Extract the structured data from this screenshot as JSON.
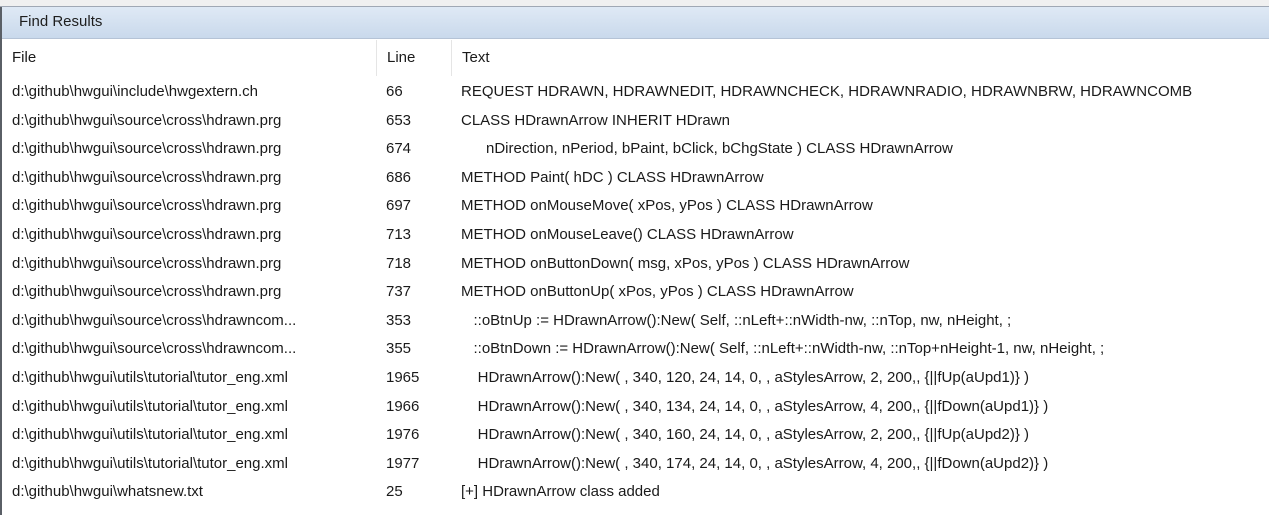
{
  "panel_title": "Find Results",
  "columns": {
    "file": "File",
    "line": "Line",
    "text": "Text"
  },
  "results": [
    {
      "file": "d:\\github\\hwgui\\include\\hwgextern.ch",
      "line": "66",
      "text": "REQUEST HDRAWN, HDRAWNEDIT, HDRAWNCHECK, HDRAWNRADIO, HDRAWNBRW, HDRAWNCOMB"
    },
    {
      "file": "d:\\github\\hwgui\\source\\cross\\hdrawn.prg",
      "line": "653",
      "text": "CLASS HDrawnArrow INHERIT HDrawn"
    },
    {
      "file": "d:\\github\\hwgui\\source\\cross\\hdrawn.prg",
      "line": "674",
      "text": "      nDirection, nPeriod, bPaint, bClick, bChgState ) CLASS HDrawnArrow"
    },
    {
      "file": "d:\\github\\hwgui\\source\\cross\\hdrawn.prg",
      "line": "686",
      "text": "METHOD Paint( hDC ) CLASS HDrawnArrow"
    },
    {
      "file": "d:\\github\\hwgui\\source\\cross\\hdrawn.prg",
      "line": "697",
      "text": "METHOD onMouseMove( xPos, yPos ) CLASS HDrawnArrow"
    },
    {
      "file": "d:\\github\\hwgui\\source\\cross\\hdrawn.prg",
      "line": "713",
      "text": "METHOD onMouseLeave() CLASS HDrawnArrow"
    },
    {
      "file": "d:\\github\\hwgui\\source\\cross\\hdrawn.prg",
      "line": "718",
      "text": "METHOD onButtonDown( msg, xPos, yPos ) CLASS HDrawnArrow"
    },
    {
      "file": "d:\\github\\hwgui\\source\\cross\\hdrawn.prg",
      "line": "737",
      "text": "METHOD onButtonUp( xPos, yPos ) CLASS HDrawnArrow"
    },
    {
      "file": "d:\\github\\hwgui\\source\\cross\\hdrawncom...",
      "line": "353",
      "text": "   ::oBtnUp := HDrawnArrow():New( Self, ::nLeft+::nWidth-nw, ::nTop, nw, nHeight, ;"
    },
    {
      "file": "d:\\github\\hwgui\\source\\cross\\hdrawncom...",
      "line": "355",
      "text": "   ::oBtnDown := HDrawnArrow():New( Self, ::nLeft+::nWidth-nw, ::nTop+nHeight-1, nw, nHeight, ;"
    },
    {
      "file": "d:\\github\\hwgui\\utils\\tutorial\\tutor_eng.xml",
      "line": "1965",
      "text": "    HDrawnArrow():New( , 340, 120, 24, 14, 0, , aStylesArrow, 2, 200,, {||fUp(aUpd1)} )"
    },
    {
      "file": "d:\\github\\hwgui\\utils\\tutorial\\tutor_eng.xml",
      "line": "1966",
      "text": "    HDrawnArrow():New( , 340, 134, 24, 14, 0, , aStylesArrow, 4, 200,, {||fDown(aUpd1)} )"
    },
    {
      "file": "d:\\github\\hwgui\\utils\\tutorial\\tutor_eng.xml",
      "line": "1976",
      "text": "    HDrawnArrow():New( , 340, 160, 24, 14, 0, , aStylesArrow, 2, 200,, {||fUp(aUpd2)} )"
    },
    {
      "file": "d:\\github\\hwgui\\utils\\tutorial\\tutor_eng.xml",
      "line": "1977",
      "text": "    HDrawnArrow():New( , 340, 174, 24, 14, 0, , aStylesArrow, 4, 200,, {||fDown(aUpd2)} )"
    },
    {
      "file": "d:\\github\\hwgui\\whatsnew.txt",
      "line": "25",
      "text": "[+] HDrawnArrow class added"
    }
  ]
}
